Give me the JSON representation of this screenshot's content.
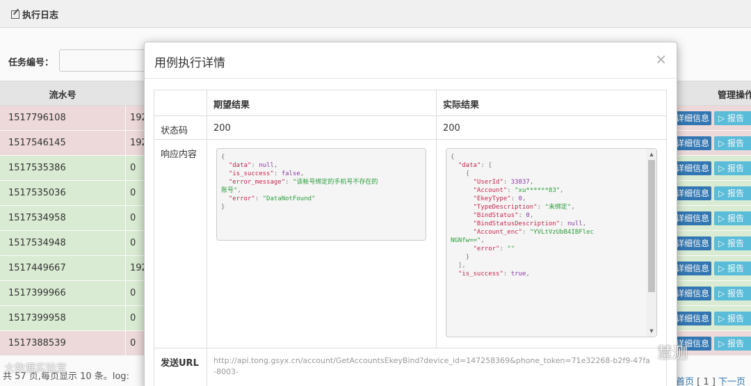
{
  "page": {
    "header_title": "执行日志",
    "search_label": "任务编号：",
    "table_header_serial": "流水号",
    "table_header_mgmt": "管理操作"
  },
  "rows": [
    {
      "id": "1517796108",
      "v2": "192",
      "status": "red",
      "detail": "详细信息",
      "report": "报告"
    },
    {
      "id": "1517546145",
      "v2": "192",
      "status": "red",
      "detail": "详细信息",
      "report": "报告"
    },
    {
      "id": "1517535386",
      "v2": "0",
      "status": "green",
      "detail": "详细信息",
      "report": "报告"
    },
    {
      "id": "1517535036",
      "v2": "0",
      "status": "green",
      "detail": "详细信息",
      "report": "报告"
    },
    {
      "id": "1517534958",
      "v2": "0",
      "status": "green",
      "detail": "详细信息",
      "report": "报告"
    },
    {
      "id": "1517534948",
      "v2": "0",
      "status": "green",
      "detail": "详细信息",
      "report": "报告"
    },
    {
      "id": "1517449667",
      "v2": "192",
      "status": "green",
      "detail": "详细信息",
      "report": "报告"
    },
    {
      "id": "1517399966",
      "v2": "0",
      "status": "green",
      "detail": "详细信息",
      "report": "报告"
    },
    {
      "id": "1517399958",
      "v2": "0",
      "status": "green",
      "detail": "详细信息",
      "report": "报告"
    },
    {
      "id": "1517388539",
      "v2": "0",
      "status": "red",
      "detail": "详细信息",
      "report": "报告"
    }
  ],
  "footer": {
    "summary": "共 57 页,每页显示 10 条。log:",
    "pagination_first": "首页",
    "pagination_current": "[ 1 ]",
    "pagination_next": "下一页"
  },
  "modal": {
    "title": "用例执行详情",
    "close": "×",
    "col_expected": "期望结果",
    "col_actual": "实际结果",
    "row_status_label": "状态码",
    "status_expected": "200",
    "status_actual": "200",
    "row_response_label": "响应内容",
    "row_url_label": "发送URL",
    "url": "http://api.tong.gsyx.cn/account/GetAccountsEkeyBind?device_id=147258369&phone_token=71e32268-b2f9-47fa-8003-"
  },
  "watermark": {
    "right": "慧测",
    "left": "大数据实验室"
  },
  "colors": {
    "row_red": "#f2dede",
    "row_green": "#dff0d8",
    "btn_detail": "#337ab7",
    "btn_report": "#5bc0de"
  }
}
